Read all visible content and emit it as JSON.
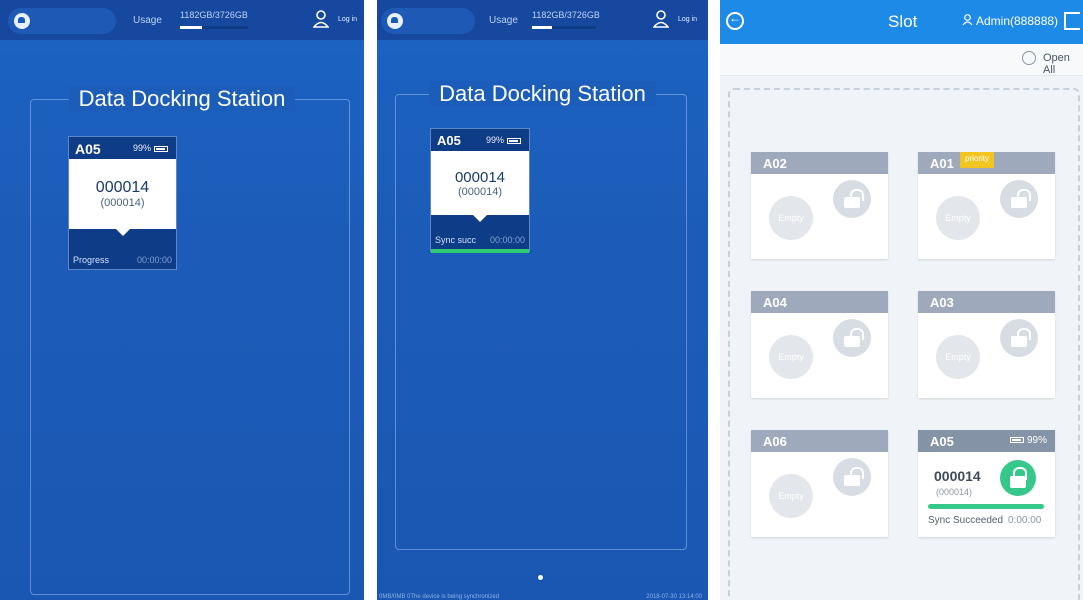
{
  "panel1": {
    "usage_label": "Usage",
    "usage_value": "1182GB/3726GB",
    "usage_fraction": 0.32,
    "login": "Log in",
    "station_title": "Data Docking Station",
    "card": {
      "slot": "A05",
      "battery": "99%",
      "id": "000014",
      "sub": "(000014)",
      "status": "Progress",
      "time": "00:00:00"
    }
  },
  "panel2": {
    "usage_label": "Usage",
    "usage_value": "1182GB/3726GB",
    "usage_fraction": 0.32,
    "login": "Log in",
    "station_title": "Data Docking Station",
    "card": {
      "slot": "A05",
      "battery": "99%",
      "id": "000014",
      "sub": "(000014)",
      "status": "Sync succ",
      "time": "00:00:00",
      "progress": 1.0
    },
    "status_left": "0MB/0MB 0The device is being synchronized",
    "status_right": "2018-07-30 13:14:00"
  },
  "panel3": {
    "title": "Slot",
    "user": "Admin(888888)",
    "open_all": "Open All",
    "slots": [
      {
        "name": "A02",
        "state": "Empty"
      },
      {
        "name": "A01",
        "state": "Empty",
        "tag": "priority"
      },
      {
        "name": "A04",
        "state": "Empty"
      },
      {
        "name": "A03",
        "state": "Empty"
      },
      {
        "name": "A06",
        "state": "Empty"
      }
    ],
    "active_slot": {
      "name": "A05",
      "battery": "99%",
      "id": "000014",
      "sub": "(000014)",
      "status": "Sync Succeeded",
      "time": "0:00:00",
      "progress": 1.0
    }
  },
  "colors": {
    "station_blue": "#1b5db8",
    "header_blue": "#1e8ae8",
    "success_green": "#36c88a",
    "priority_yellow": "#f3c521"
  }
}
